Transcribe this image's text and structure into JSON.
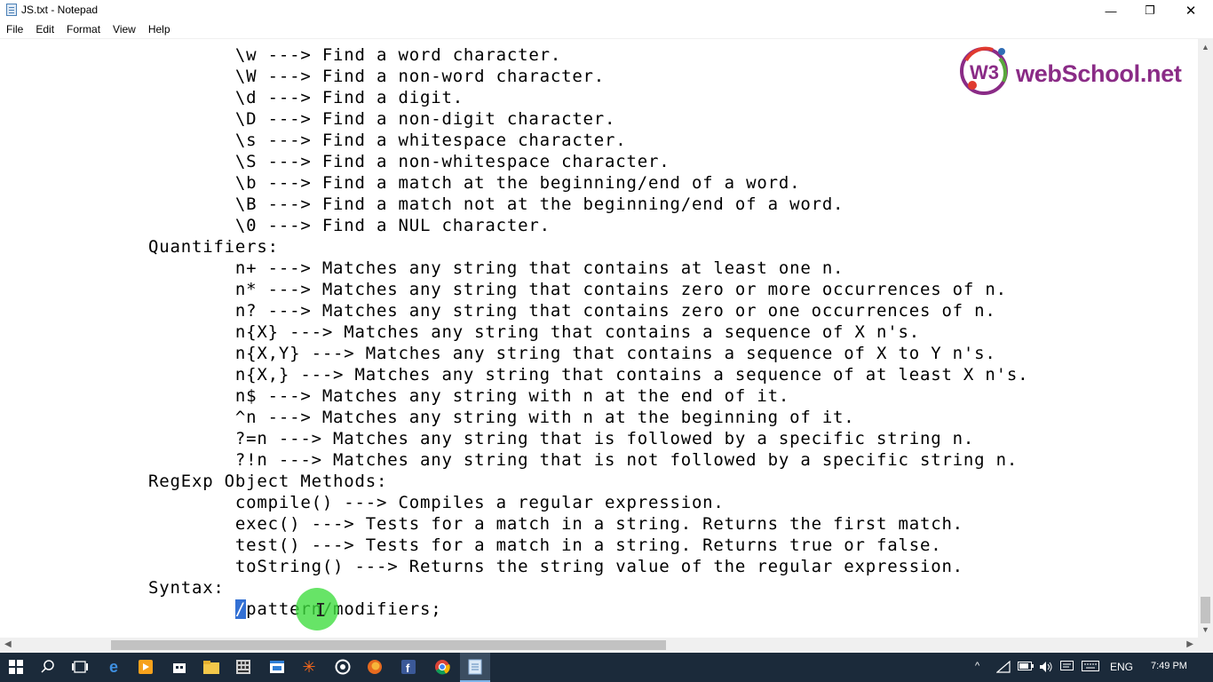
{
  "window": {
    "title": "JS.txt - Notepad",
    "minimize": "—",
    "maximize": "❐",
    "close": "✕"
  },
  "menu": [
    "File",
    "Edit",
    "Format",
    "View",
    "Help"
  ],
  "editor": {
    "lines": [
      "        \\w ---> Find a word character.",
      "        \\W ---> Find a non-word character.",
      "        \\d ---> Find a digit.",
      "        \\D ---> Find a non-digit character.",
      "        \\s ---> Find a whitespace character.",
      "        \\S ---> Find a non-whitespace character.",
      "        \\b ---> Find a match at the beginning/end of a word.",
      "        \\B ---> Find a match not at the beginning/end of a word.",
      "        \\0 ---> Find a NUL character.",
      "Quantifiers:",
      "        n+ ---> Matches any string that contains at least one n.",
      "        n* ---> Matches any string that contains zero or more occurrences of n.",
      "        n? ---> Matches any string that contains zero or one occurrences of n.",
      "        n{X} ---> Matches any string that contains a sequence of X n's.",
      "        n{X,Y} ---> Matches any string that contains a sequence of X to Y n's.",
      "        n{X,} ---> Matches any string that contains a sequence of at least X n's.",
      "        n$ ---> Matches any string with n at the end of it.",
      "        ^n ---> Matches any string with n at the beginning of it.",
      "        ?=n ---> Matches any string that is followed by a specific string n.",
      "        ?!n ---> Matches any string that is not followed by a specific string n.",
      "RegExp Object Methods:",
      "        compile() ---> Compiles a regular expression.",
      "        exec() ---> Tests for a match in a string. Returns the first match.",
      "        test() ---> Tests for a match in a string. Returns true or false.",
      "        toString() ---> Returns the string value of the regular expression.",
      "Syntax:"
    ],
    "last_line_indent": "        ",
    "last_line_selected": "/",
    "last_line_rest": "pattern/modifiers;"
  },
  "logo": {
    "badge": "W3",
    "text": "webSchool.net",
    "colors": {
      "purple": "#8a2b86",
      "red": "#e03a2f",
      "green": "#5aa83c",
      "blue": "#2f6db5"
    }
  },
  "taskbar": {
    "icons": [
      "windows-start-icon",
      "search-icon",
      "task-view-icon",
      "edge-icon",
      "media-player-icon",
      "store-icon",
      "file-explorer-icon",
      "calculator-icon",
      "app-window-icon",
      "sparkle-app-icon",
      "camtasia-icon",
      "firefox-icon",
      "facebook-icon",
      "chrome-icon",
      "notepad-icon"
    ],
    "language": "ENG",
    "time": "7:49 PM"
  }
}
